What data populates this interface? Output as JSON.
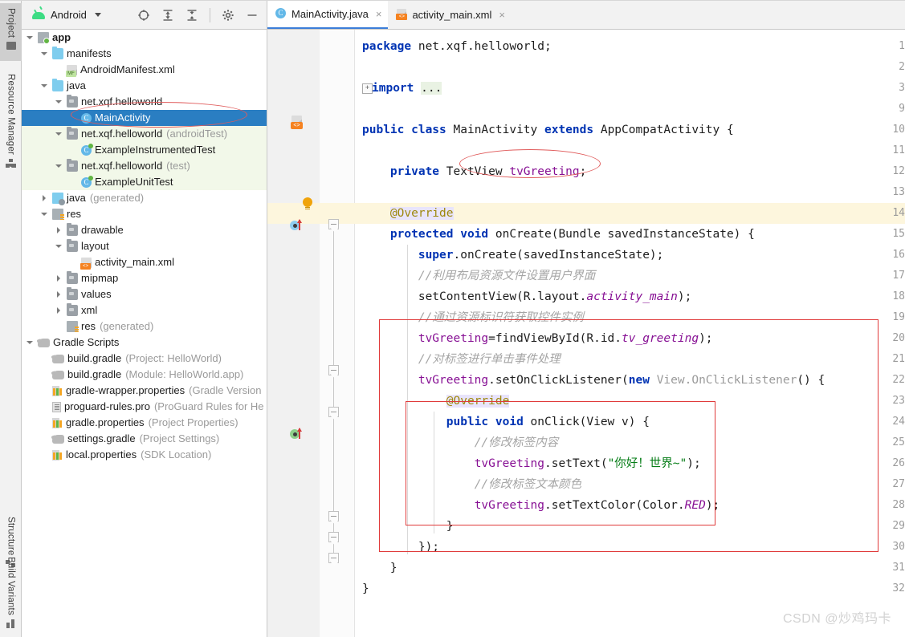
{
  "toolwindows": {
    "left_top": [
      {
        "label": "Project",
        "icon": "folder-icon",
        "active": true
      },
      {
        "label": "Resource Manager",
        "icon": "resource-icon",
        "active": false
      }
    ],
    "left_bottom": [
      {
        "label": "Structure",
        "icon": "structure-icon",
        "active": false
      },
      {
        "label": "Build Variants",
        "icon": "build-variants-icon",
        "active": false
      }
    ]
  },
  "panel": {
    "title": "Android",
    "logo_icon": "android-robot-icon",
    "dropdown_icon": "chevron-down-icon",
    "header_buttons": [
      {
        "name": "select-opened-file-icon",
        "tooltip": "Select Opened File"
      },
      {
        "name": "expand-all-icon",
        "tooltip": "Expand All"
      },
      {
        "name": "collapse-all-icon",
        "tooltip": "Collapse All"
      },
      {
        "name": "gear-icon",
        "tooltip": "Settings"
      },
      {
        "name": "hide-icon",
        "tooltip": "Hide"
      }
    ]
  },
  "tree": [
    {
      "label": "app",
      "sub": "",
      "indent": 0,
      "arrow": "down",
      "icon": "module",
      "bold": true,
      "green": false,
      "selected": false
    },
    {
      "label": "manifests",
      "sub": "",
      "indent": 1,
      "arrow": "down",
      "icon": "folder-blue",
      "bold": false,
      "green": false,
      "selected": false
    },
    {
      "label": "AndroidManifest.xml",
      "sub": "",
      "indent": 2,
      "arrow": "none",
      "icon": "manifest",
      "bold": false,
      "green": false,
      "selected": false
    },
    {
      "label": "java",
      "sub": "",
      "indent": 1,
      "arrow": "down",
      "icon": "folder-blue",
      "bold": false,
      "green": false,
      "selected": false
    },
    {
      "label": "net.xqf.helloworld",
      "sub": "",
      "indent": 2,
      "arrow": "down",
      "icon": "folder-gray",
      "bold": false,
      "green": false,
      "selected": false
    },
    {
      "label": "MainActivity",
      "sub": "",
      "indent": 3,
      "arrow": "none",
      "icon": "classfile",
      "bold": false,
      "green": false,
      "selected": true
    },
    {
      "label": "net.xqf.helloworld",
      "sub": "(androidTest)",
      "indent": 2,
      "arrow": "down",
      "icon": "folder-gray",
      "bold": false,
      "green": true,
      "selected": false
    },
    {
      "label": "ExampleInstrumentedTest",
      "sub": "",
      "indent": 3,
      "arrow": "none",
      "icon": "classtest",
      "bold": false,
      "green": true,
      "selected": false
    },
    {
      "label": "net.xqf.helloworld",
      "sub": "(test)",
      "indent": 2,
      "arrow": "down",
      "icon": "folder-gray",
      "bold": false,
      "green": true,
      "selected": false
    },
    {
      "label": "ExampleUnitTest",
      "sub": "",
      "indent": 3,
      "arrow": "none",
      "icon": "classtest",
      "bold": false,
      "green": true,
      "selected": false
    },
    {
      "label": "java",
      "sub": "(generated)",
      "indent": 1,
      "arrow": "right",
      "icon": "javagen",
      "bold": false,
      "green": false,
      "selected": false
    },
    {
      "label": "res",
      "sub": "",
      "indent": 1,
      "arrow": "down",
      "icon": "resfolder",
      "bold": false,
      "green": false,
      "selected": false
    },
    {
      "label": "drawable",
      "sub": "",
      "indent": 2,
      "arrow": "right",
      "icon": "folder-gray",
      "bold": false,
      "green": false,
      "selected": false
    },
    {
      "label": "layout",
      "sub": "",
      "indent": 2,
      "arrow": "down",
      "icon": "folder-gray",
      "bold": false,
      "green": false,
      "selected": false
    },
    {
      "label": "activity_main.xml",
      "sub": "",
      "indent": 3,
      "arrow": "none",
      "icon": "xmlfile",
      "bold": false,
      "green": false,
      "selected": false
    },
    {
      "label": "mipmap",
      "sub": "",
      "indent": 2,
      "arrow": "right",
      "icon": "folder-gray",
      "bold": false,
      "green": false,
      "selected": false
    },
    {
      "label": "values",
      "sub": "",
      "indent": 2,
      "arrow": "right",
      "icon": "folder-gray",
      "bold": false,
      "green": false,
      "selected": false
    },
    {
      "label": "xml",
      "sub": "",
      "indent": 2,
      "arrow": "right",
      "icon": "folder-gray",
      "bold": false,
      "green": false,
      "selected": false
    },
    {
      "label": "res",
      "sub": "(generated)",
      "indent": 2,
      "arrow": "none",
      "icon": "resfolder",
      "bold": false,
      "green": false,
      "selected": false
    },
    {
      "label": "Gradle Scripts",
      "sub": "",
      "indent": 0,
      "arrow": "down",
      "icon": "gradle",
      "bold": false,
      "green": false,
      "selected": false
    },
    {
      "label": "build.gradle",
      "sub": "(Project: HelloWorld)",
      "indent": 1,
      "arrow": "none",
      "icon": "gradle",
      "bold": false,
      "green": false,
      "selected": false
    },
    {
      "label": "build.gradle",
      "sub": "(Module: HelloWorld.app)",
      "indent": 1,
      "arrow": "none",
      "icon": "gradle",
      "bold": false,
      "green": false,
      "selected": false
    },
    {
      "label": "gradle-wrapper.properties",
      "sub": "(Gradle Version",
      "indent": 1,
      "arrow": "none",
      "icon": "props",
      "bold": false,
      "green": false,
      "selected": false
    },
    {
      "label": "proguard-rules.pro",
      "sub": "(ProGuard Rules for He",
      "indent": 1,
      "arrow": "none",
      "icon": "txtfile",
      "bold": false,
      "green": false,
      "selected": false
    },
    {
      "label": "gradle.properties",
      "sub": "(Project Properties)",
      "indent": 1,
      "arrow": "none",
      "icon": "props",
      "bold": false,
      "green": false,
      "selected": false
    },
    {
      "label": "settings.gradle",
      "sub": "(Project Settings)",
      "indent": 1,
      "arrow": "none",
      "icon": "gradle",
      "bold": false,
      "green": false,
      "selected": false
    },
    {
      "label": "local.properties",
      "sub": "(SDK Location)",
      "indent": 1,
      "arrow": "none",
      "icon": "props",
      "bold": false,
      "green": false,
      "selected": false
    }
  ],
  "editor": {
    "tabs": [
      {
        "label": "MainActivity.java",
        "icon": "java-class-icon",
        "active": true,
        "close_glyph": "×"
      },
      {
        "label": "activity_main.xml",
        "icon": "xml-layout-icon",
        "active": false,
        "close_glyph": "×"
      }
    ],
    "line_numbers": [
      "1",
      "2",
      "3",
      "9",
      "10",
      "11",
      "12",
      "13",
      "14",
      "15",
      "16",
      "17",
      "18",
      "19",
      "20",
      "21",
      "22",
      "23",
      "24",
      "25",
      "26",
      "27",
      "28",
      "29",
      "30",
      "31",
      "32"
    ],
    "lines": [
      {
        "n": "1",
        "html": "<span class='kw'>package</span> <span class='plain'>net.xqf.helloworld;</span>"
      },
      {
        "n": "2",
        "html": ""
      },
      {
        "n": "3",
        "html": "<span class='fold-plus'>+</span><span class='kw'>import</span> <span class='foldbg'>...</span>"
      },
      {
        "n": "9",
        "html": ""
      },
      {
        "n": "10",
        "html": "<span class='kw'>public class</span> <span class='plain'>MainActivity</span> <span class='kw'>extends</span> <span class='plain'>AppCompatActivity {</span>"
      },
      {
        "n": "11",
        "html": ""
      },
      {
        "n": "12",
        "html": "    <span class='kw'>private</span> <span class='plain'>TextView</span> <span class='field'>tvGreeting</span><span class='plain'>;</span>"
      },
      {
        "n": "13",
        "html": ""
      },
      {
        "n": "14",
        "html": "    <span class='anno annobg'>@Override</span>"
      },
      {
        "n": "15",
        "html": "    <span class='kw'>protected void</span> <span class='plain'>onCreate(Bundle savedInstanceState) {</span>"
      },
      {
        "n": "16",
        "html": "        <span class='kw'>super</span><span class='plain'>.onCreate(savedInstanceState);</span>"
      },
      {
        "n": "17",
        "html": "        <span class='cmt'>//利用布局资源文件设置用户界面</span>"
      },
      {
        "n": "18",
        "html": "        <span class='plain'>setContentView(R.layout.</span><span class='static'>activity_main</span><span class='plain'>);</span>"
      },
      {
        "n": "19",
        "html": "        <span class='cmt'>//通过资源标识符获取控件实例</span>"
      },
      {
        "n": "20",
        "html": "        <span class='field'>tvGreeting</span><span class='plain'>=findViewById(R.id.</span><span class='static'>tv_greeting</span><span class='plain'>);</span>"
      },
      {
        "n": "21",
        "html": "        <span class='cmt'>//对标签进行单击事件处理</span>"
      },
      {
        "n": "22",
        "html": "        <span class='field'>tvGreeting</span><span class='plain'>.setOnClickListener(</span><span class='kw'>new</span> <span class='gray'>View.OnClickListener</span><span class='plain'>() {</span>"
      },
      {
        "n": "23",
        "html": "            <span class='anno annobg'>@Override</span>"
      },
      {
        "n": "24",
        "html": "            <span class='kw'>public void</span> <span class='plain'>onClick(View v) {</span>"
      },
      {
        "n": "25",
        "html": "                <span class='cmt'>//修改标签内容</span>"
      },
      {
        "n": "26",
        "html": "                <span class='field'>tvGreeting</span><span class='plain'>.setText(</span><span class='str'>\"你好！世界~\"</span><span class='plain'>);</span>"
      },
      {
        "n": "27",
        "html": "                <span class='cmt'>//修改标签文本颜色</span>"
      },
      {
        "n": "28",
        "html": "                <span class='field'>tvGreeting</span><span class='plain'>.setTextColor(Color.</span><span class='static'>RED</span><span class='plain'>);</span>"
      },
      {
        "n": "29",
        "html": "            <span class='plain'>}</span>"
      },
      {
        "n": "30",
        "html": "        <span class='plain'>});</span>"
      },
      {
        "n": "31",
        "html": "    <span class='plain'>}</span>"
      },
      {
        "n": "32",
        "html": "<span class='plain'>}</span>"
      }
    ],
    "gutter_markers": [
      {
        "line": "14",
        "name": "intention-bulb-icon"
      },
      {
        "line": "15",
        "name": "overriding-method-icon"
      },
      {
        "line": "24",
        "name": "implementing-method-icon"
      }
    ],
    "highlighted_line": "14"
  },
  "annotations": {
    "ellipse_target": "tvGreeting;",
    "outer_box_target": "findViewById / setOnClickListener block",
    "inner_box_target": "onClick method body",
    "sidebar_ellipse_target": "MainActivity",
    "color": "#e03a3a"
  },
  "watermark": "CSDN @炒鸡玛卡"
}
